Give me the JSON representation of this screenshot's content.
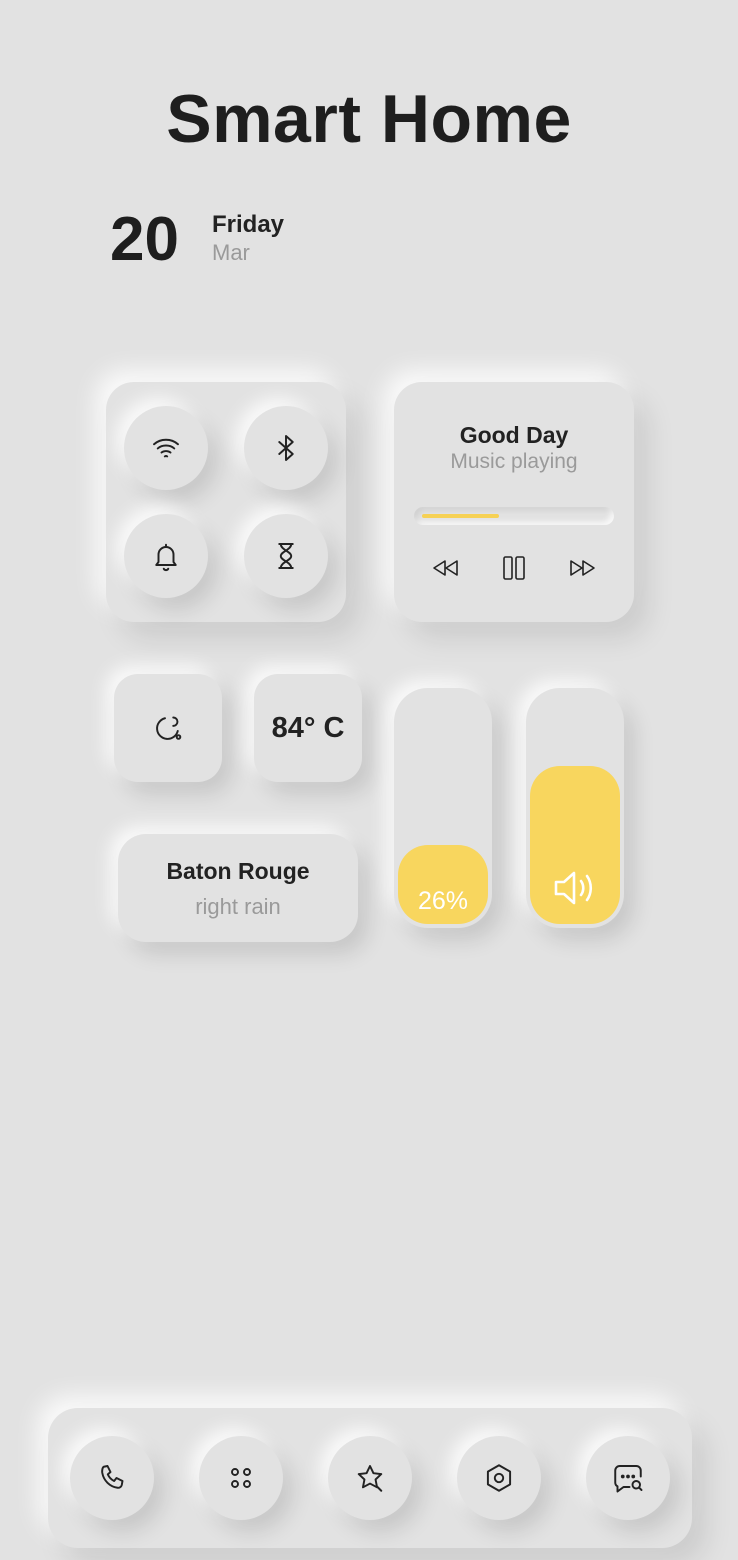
{
  "header": {
    "title": "Smart Home",
    "date_number": "20",
    "date_day": "Friday",
    "date_month": "Mar"
  },
  "quick_toggles": [
    {
      "icon": "wifi-icon"
    },
    {
      "icon": "bluetooth-icon"
    },
    {
      "icon": "bell-icon"
    },
    {
      "icon": "hourglass-icon"
    }
  ],
  "music": {
    "title": "Good Day",
    "status": "Music playing",
    "progress": 0.42,
    "controls": [
      "rewind-icon",
      "pause-icon",
      "fast-forward-icon"
    ]
  },
  "weather": {
    "icon": "moon-icon",
    "temperature": "84° C",
    "city": "Baton Rouge",
    "condition": "right rain"
  },
  "sliders": {
    "brightness": {
      "value": 0.34,
      "label": "26%"
    },
    "volume": {
      "value": 0.68,
      "icon": "speaker-icon"
    }
  },
  "dock": [
    "phone-icon",
    "apps-grid-icon",
    "star-icon",
    "settings-hex-icon",
    "chat-search-icon"
  ],
  "colors": {
    "background": "#e2e2e2",
    "accent": "#f8d65e",
    "text": "#222222",
    "muted": "#9a9a9a"
  }
}
